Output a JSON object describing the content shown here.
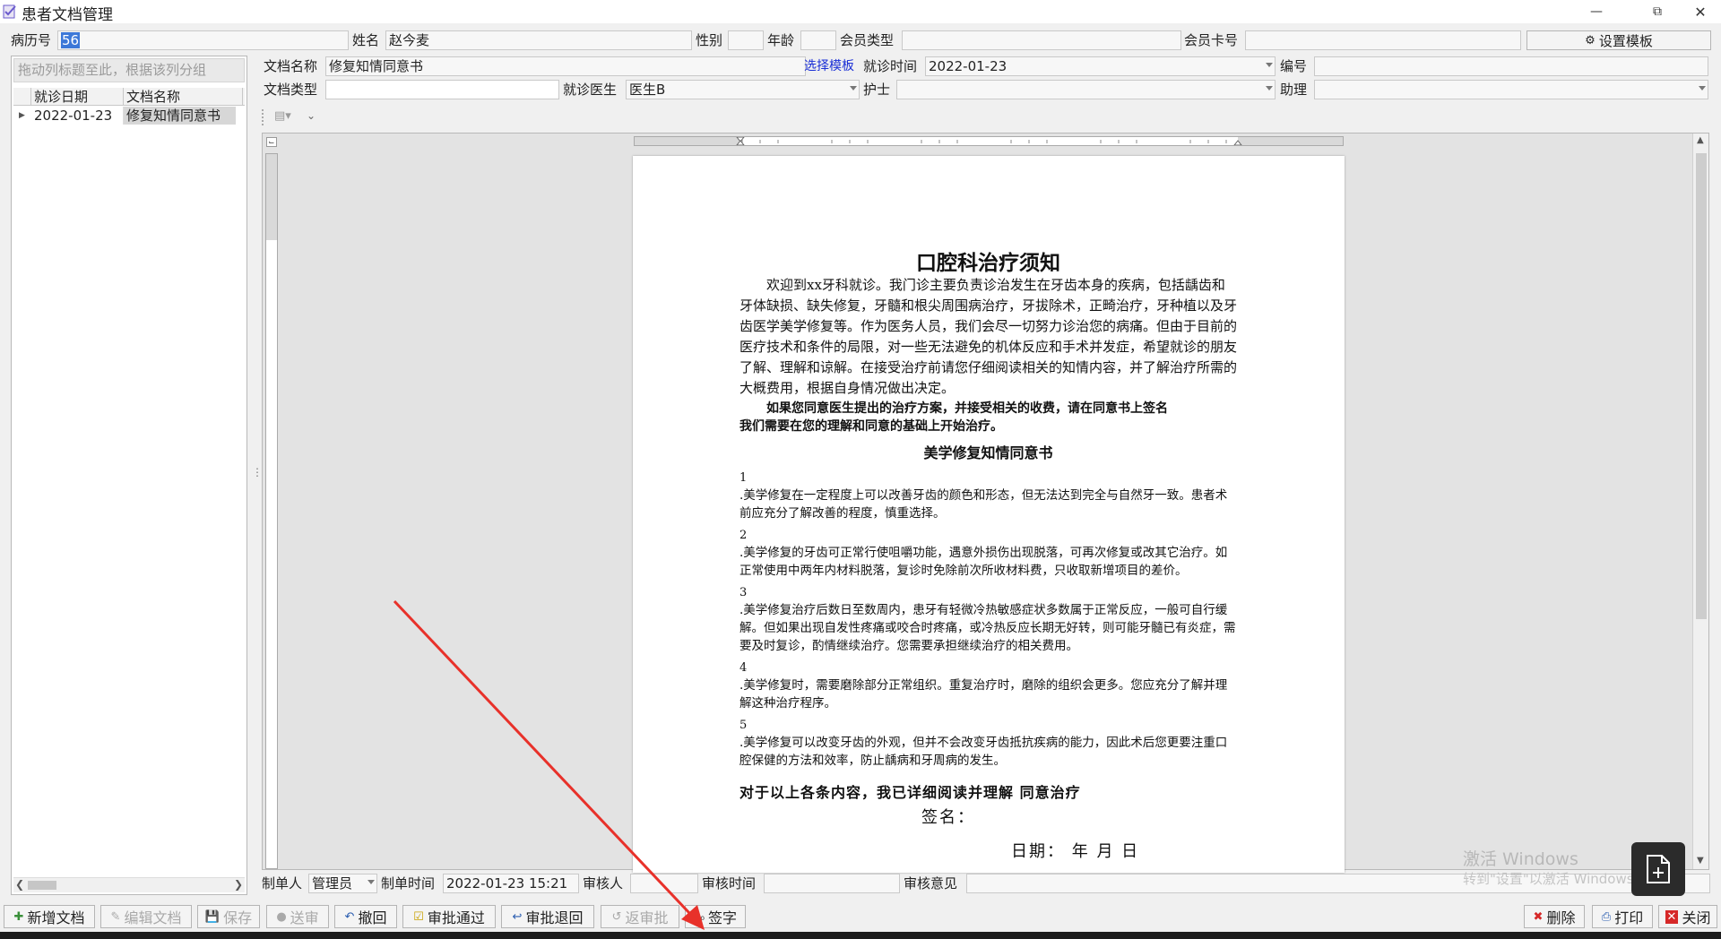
{
  "window": {
    "title": "患者文档管理"
  },
  "patient": {
    "record_no_label": "病历号",
    "record_no_value": "56",
    "name_label": "姓名",
    "name_value": "赵今麦",
    "gender_label": "性别",
    "gender_value": "",
    "age_label": "年龄",
    "age_value": "",
    "member_type_label": "会员类型",
    "member_type_value": "",
    "member_card_label": "会员卡号",
    "member_card_value": "",
    "template_settings_button": "设置模板"
  },
  "left_panel": {
    "group_hint": "拖动列标题至此，根据该列分组",
    "columns": [
      "就诊日期",
      "文档名称"
    ],
    "rows": [
      {
        "date": "2022-01-23",
        "name": "修复知情同意书"
      }
    ]
  },
  "doc_form": {
    "doc_name_label": "文档名称",
    "doc_name_value": "修复知情同意书",
    "select_template_link": "选择模板",
    "visit_time_label": "就诊时间",
    "visit_time_value": "2022-01-23",
    "number_label": "编号",
    "number_value": "",
    "doc_type_label": "文档类型",
    "doc_type_value": "",
    "doctor_label": "就诊医生",
    "doctor_value": "医生B",
    "nurse_label": "护士",
    "nurse_value": "",
    "assistant_label": "助理",
    "assistant_value": ""
  },
  "document": {
    "title": "口腔科治疗须知",
    "intro_paragraph": "欢迎到xx牙科就诊。我门诊主要负责诊治发生在牙齿本身的疾病，包括龋齿和牙体缺损、缺失修复，牙髓和根尖周围病治疗，牙拔除术，正畸治疗，牙种植以及牙齿医学美学修复等。作为医务人员，我们会尽一切努力诊治您的病痛。但由于目前的医疗技术和条件的局限，对一些无法避免的机体反应和手术并发症，希望就诊的朋友了解、理解和谅解。在接受治疗前请您仔细阅读相关的知情内容，并了解治疗所需的大概费用，根据自身情况做出决定。",
    "bold_line_1": "如果您同意医生提出的治疗方案，并接受相关的收费，请在同意书上签名",
    "bold_line_2": "我们需要在您的理解和同意的基础上开始治疗。",
    "subtitle": "美学修复知情同意书",
    "items": [
      {
        "num": "1",
        "text": ".美学修复在一定程度上可以改善牙齿的颜色和形态，但无法达到完全与自然牙一致。患者术前应充分了解改善的程度，慎重选择。"
      },
      {
        "num": "2",
        "text": ".美学修复的牙齿可正常行使咀嚼功能，遇意外损伤出现脱落，可再次修复或改其它治疗。如正常使用中两年内材料脱落，复诊时免除前次所收材料费，只收取新增项目的差价。"
      },
      {
        "num": "3",
        "text": ".美学修复治疗后数日至数周内，患牙有轻微冷热敏感症状多数属于正常反应，一般可自行缓解。但如果出现自发性疼痛或咬合时疼痛，或冷热反应长期无好转，则可能牙髓已有炎症，需要及时复诊，酌情继续治疗。您需要承担继续治疗的相关费用。"
      },
      {
        "num": "4",
        "text": ".美学修复时，需要磨除部分正常组织。重复治疗时，磨除的组织会更多。您应充分了解并理解这种治疗程序。"
      },
      {
        "num": "5",
        "text": ".美学修复可以改变牙齿的外观，但并不会改变牙齿抵抗疾病的能力，因此术后您更要注重口腔保健的方法和效率，防止龋病和牙周病的发生。"
      }
    ],
    "confirm_line": "对于以上各条内容，我已详细阅读并理解 同意治疗",
    "signature_label": "签名：",
    "date_line": "日期：  年  月  日"
  },
  "footer_form": {
    "creator_label": "制单人",
    "creator_value": "管理员",
    "create_time_label": "制单时间",
    "create_time_value": "2022-01-23 15:21",
    "reviewer_label": "审核人",
    "reviewer_value": "",
    "review_time_label": "审核时间",
    "review_time_value": "",
    "review_opinion_label": "审核意见",
    "review_opinion_value": ""
  },
  "toolbar": {
    "new_doc": "新增文档",
    "edit_doc": "编辑文档",
    "save": "保存",
    "submit": "送审",
    "revoke": "撤回",
    "approve": "审批通过",
    "reject": "审批退回",
    "unapprove": "返审批",
    "sign": "签字",
    "delete": "删除",
    "print": "打印",
    "close": "关闭"
  },
  "watermark": {
    "line1": "激活 Windows",
    "line2": "转到\"设置\"以激活 Windows。"
  },
  "colors": {
    "selection": "#3c78d8",
    "link": "#1a2fd6",
    "annotation_arrow": "#e8312a",
    "delete_icon": "#d62828",
    "close_icon": "#d62828"
  }
}
